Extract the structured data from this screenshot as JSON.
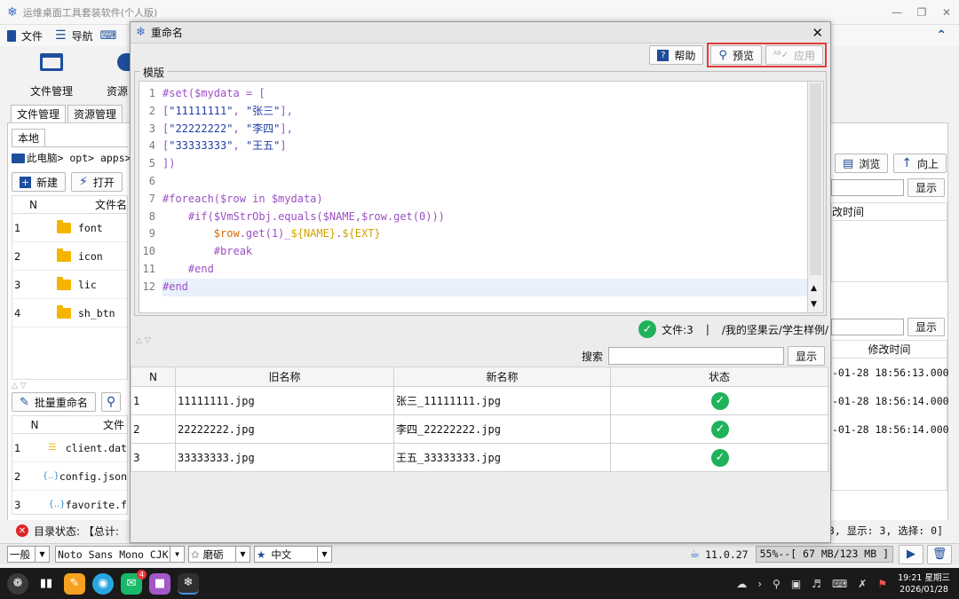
{
  "window": {
    "title": "运维桌面工具套装软件(个人版)"
  },
  "menu": {
    "file": "文件",
    "nav": "导航",
    "collapse_icon": "double-chevron-up-icon"
  },
  "toolbar": {
    "file_manager": "文件管理",
    "resource_partial": "资源"
  },
  "tabs": {
    "file_manager": "文件管理",
    "resource_manager": "资源管理",
    "local": "本地"
  },
  "breadcrumb": {
    "text": "此电脑> opt> apps>"
  },
  "left_buttons": {
    "new": "新建",
    "open": "打开"
  },
  "left_table": {
    "headers": [
      "N",
      "文件名"
    ],
    "rows": [
      {
        "n": "1",
        "name": "font"
      },
      {
        "n": "2",
        "name": "icon"
      },
      {
        "n": "3",
        "name": "lic"
      },
      {
        "n": "4",
        "name": "sh_btn"
      }
    ]
  },
  "lower_left": {
    "batch_rename": "批量重命名",
    "headers": [
      "N",
      "文件"
    ],
    "rows": [
      {
        "n": "1",
        "name": "client.dat"
      },
      {
        "n": "2",
        "name": "config.json"
      },
      {
        "n": "3",
        "name": "favorite.f"
      }
    ]
  },
  "right_panel": {
    "browse": "浏览",
    "up": "向上",
    "show": "显示",
    "modified_header_top": "改时间",
    "modified_header": "修改时间",
    "times": [
      "-01-28 18:56:13.000",
      "-01-28 18:56:14.000",
      "-01-28 18:56:14.000"
    ]
  },
  "dialog": {
    "title": "重命名",
    "help": "帮助",
    "preview": "预览",
    "apply": "应用",
    "template_label": "模版",
    "code": [
      "#set($mydata = [",
      "[\"11111111\", \"张三\"],",
      "[\"22222222\", \"李四\"],",
      "[\"33333333\", \"王五\"]",
      "])",
      "",
      "#foreach($row in $mydata)",
      "    #if($VmStrObj.equals($NAME,$row.get(0)))",
      "        $row.get(1)_${NAME}.${EXT}",
      "        #break",
      "    #end",
      "#end"
    ],
    "file_count": "文件:3",
    "separator": "|",
    "path": "/我的坚果云/学生样例/",
    "search_label": "搜索",
    "search_value": "",
    "show": "显示",
    "table": {
      "headers": [
        "N",
        "旧名称",
        "新名称",
        "状态"
      ],
      "rows": [
        {
          "n": "1",
          "old": "11111111.jpg",
          "new": "张三_11111111.jpg"
        },
        {
          "n": "2",
          "old": "22222222.jpg",
          "new": "李四_22222222.jpg"
        },
        {
          "n": "3",
          "old": "33333333.jpg",
          "new": "王五_33333333.jpg"
        }
      ]
    }
  },
  "status": {
    "dir_status": "目录状态: 【总计:",
    "right": "3, 显示: 3, 选择: 0]"
  },
  "bottom": {
    "mode": "一般",
    "font": "Noto Sans Mono CJK SC",
    "skin": "磨砺",
    "lang": "中文",
    "java": "11.0.27",
    "memory": "55%--[ 67 MB/123 MB ]"
  },
  "taskbar": {
    "time": "19:21 星期三",
    "date": "2026/01/28",
    "badge": "4"
  },
  "colors": {
    "highlight_border": "#e23b3b",
    "ok_green": "#1fb25a",
    "accent_blue": "#1565c0"
  }
}
